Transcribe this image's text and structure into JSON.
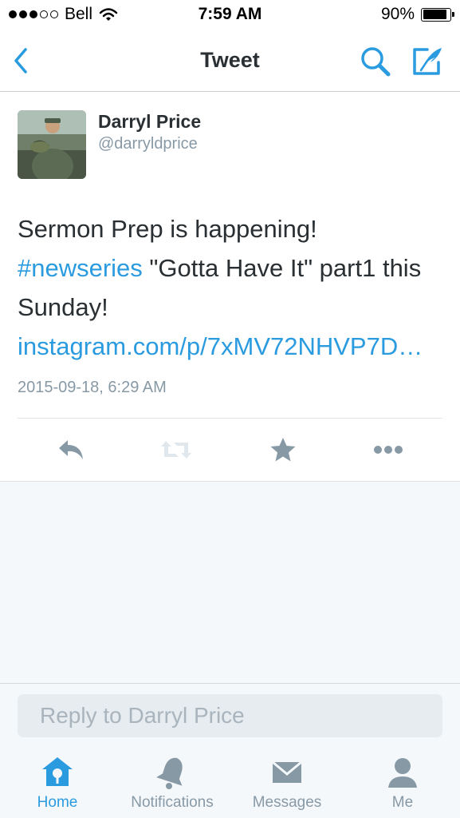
{
  "status_bar": {
    "carrier": "Bell",
    "time": "7:59 AM",
    "battery": "90%",
    "battery_level": 0.9,
    "signal_bars": 3,
    "signal_total": 5
  },
  "nav": {
    "title": "Tweet",
    "back_icon": "chevron-left-icon",
    "search_icon": "search-icon",
    "compose_icon": "compose-icon"
  },
  "tweet": {
    "author_name": "Darryl Price",
    "author_handle": "@darryldprice",
    "text_part1": "Sermon Prep is happening! ",
    "hashtag": "#newseries",
    "text_part2": " \"Gotta Have It\" part1 this Sunday! ",
    "link": "instagram.com/p/7xMV72NHVP7D…",
    "timestamp": "2015-09-18, 6:29 AM"
  },
  "actions": [
    {
      "name": "reply",
      "icon": "reply-icon"
    },
    {
      "name": "retweet",
      "icon": "retweet-icon"
    },
    {
      "name": "favorite",
      "icon": "star-icon"
    },
    {
      "name": "more",
      "icon": "more-icon"
    }
  ],
  "reply_box": {
    "placeholder": "Reply to Darryl Price"
  },
  "tabs": [
    {
      "label": "Home",
      "icon": "home-icon",
      "active": true
    },
    {
      "label": "Notifications",
      "icon": "bell-icon",
      "active": false
    },
    {
      "label": "Messages",
      "icon": "envelope-icon",
      "active": false
    },
    {
      "label": "Me",
      "icon": "person-icon",
      "active": false
    }
  ],
  "colors": {
    "accent": "#2b9be0",
    "icon_gray": "#8899a6",
    "text": "#292f33",
    "background_gray": "#f5f8fa"
  }
}
